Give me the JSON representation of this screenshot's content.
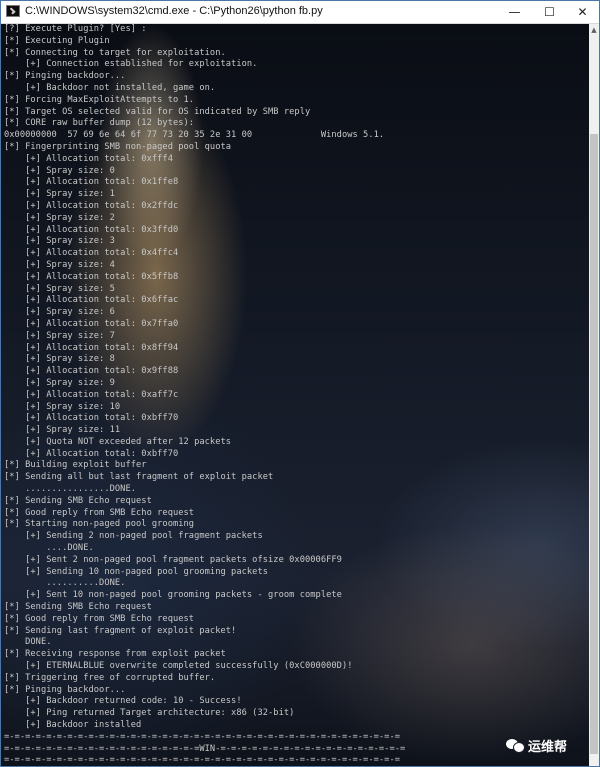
{
  "window": {
    "title": "C:\\WINDOWS\\system32\\cmd.exe - C:\\Python26\\python  fb.py",
    "minimize_glyph": "—",
    "maximize_glyph": "☐",
    "close_glyph": "✕"
  },
  "console": {
    "lines": [
      "[?] Execute Plugin? [Yes] :",
      "[*] Executing Plugin",
      "[*] Connecting to target for exploitation.",
      "    [+] Connection established for exploitation.",
      "[*] Pinging backdoor...",
      "    [+] Backdoor not installed, game on.",
      "[*] Forcing MaxExploitAttempts to 1.",
      "[*] Target OS selected valid for OS indicated by SMB reply",
      "[*] CORE raw buffer dump (12 bytes):",
      "0x00000000  57 69 6e 64 6f 77 73 20 35 2e 31 00             Windows 5.1.",
      "[*] Fingerprinting SMB non-paged pool quota",
      "    [+] Allocation total: 0xfff4",
      "    [+] Spray size: 0",
      "    [+] Allocation total: 0x1ffe8",
      "    [+] Spray size: 1",
      "    [+] Allocation total: 0x2ffdc",
      "    [+] Spray size: 2",
      "    [+] Allocation total: 0x3ffd0",
      "    [+] Spray size: 3",
      "    [+] Allocation total: 0x4ffc4",
      "    [+] Spray size: 4",
      "    [+] Allocation total: 0x5ffb8",
      "    [+] Spray size: 5",
      "    [+] Allocation total: 0x6ffac",
      "    [+] Spray size: 6",
      "    [+] Allocation total: 0x7ffa0",
      "    [+] Spray size: 7",
      "    [+] Allocation total: 0x8ff94",
      "    [+] Spray size: 8",
      "    [+] Allocation total: 0x9ff88",
      "    [+] Spray size: 9",
      "    [+] Allocation total: 0xaff7c",
      "    [+] Spray size: 10",
      "    [+] Allocation total: 0xbff70",
      "    [+] Spray size: 11",
      "    [+] Quota NOT exceeded after 12 packets",
      "    [+] Allocation total: 0xbff70",
      "[*] Building exploit buffer",
      "[*] Sending all but last fragment of exploit packet",
      "    ................DONE.",
      "[*] Sending SMB Echo request",
      "[*] Good reply from SMB Echo request",
      "[*] Starting non-paged pool grooming",
      "    [+] Sending 2 non-paged pool fragment packets",
      "        ....DONE.",
      "    [+] Sent 2 non-paged pool fragment packets ofsize 0x00006FF9",
      "    [+] Sending 10 non-paged pool grooming packets",
      "        ..........DONE.",
      "    [+] Sent 10 non-paged pool grooming packets - groom complete",
      "[*] Sending SMB Echo request",
      "[*] Good reply from SMB Echo request",
      "[*] Sending last fragment of exploit packet!",
      "    DONE.",
      "[*] Receiving response from exploit packet",
      "    [+] ETERNALBLUE overwrite completed successfully (0xC000000D)!",
      "[*] Triggering free of corrupted buffer.",
      "[*] Pinging backdoor...",
      "    [+] Backdoor returned code: 10 - Success!",
      "    [+] Ping returned Target architecture: x86 (32-bit)",
      "    [+] Backdoor installed",
      "=-=-=-=-=-=-=-=-=-=-=-=-=-=-=-=-=-=-=-=-=-=-=-=-=-=-=-=-=-=-=-=-=-=-=-=-=-=",
      "=-=-=-=-=-=-=-=-=-=-=-=-=-=-=-=-=-=-=WIN-=-=-=-=-=-=-=-=-=-=-=-=-=-=-=-=-=-=",
      "=-=-=-=-=-=-=-=-=-=-=-=-=-=-=-=-=-=-=-=-=-=-=-=-=-=-=-=-=-=-=-=-=-=-=-=-=-="
    ]
  },
  "watermark": {
    "text": "运维帮"
  }
}
